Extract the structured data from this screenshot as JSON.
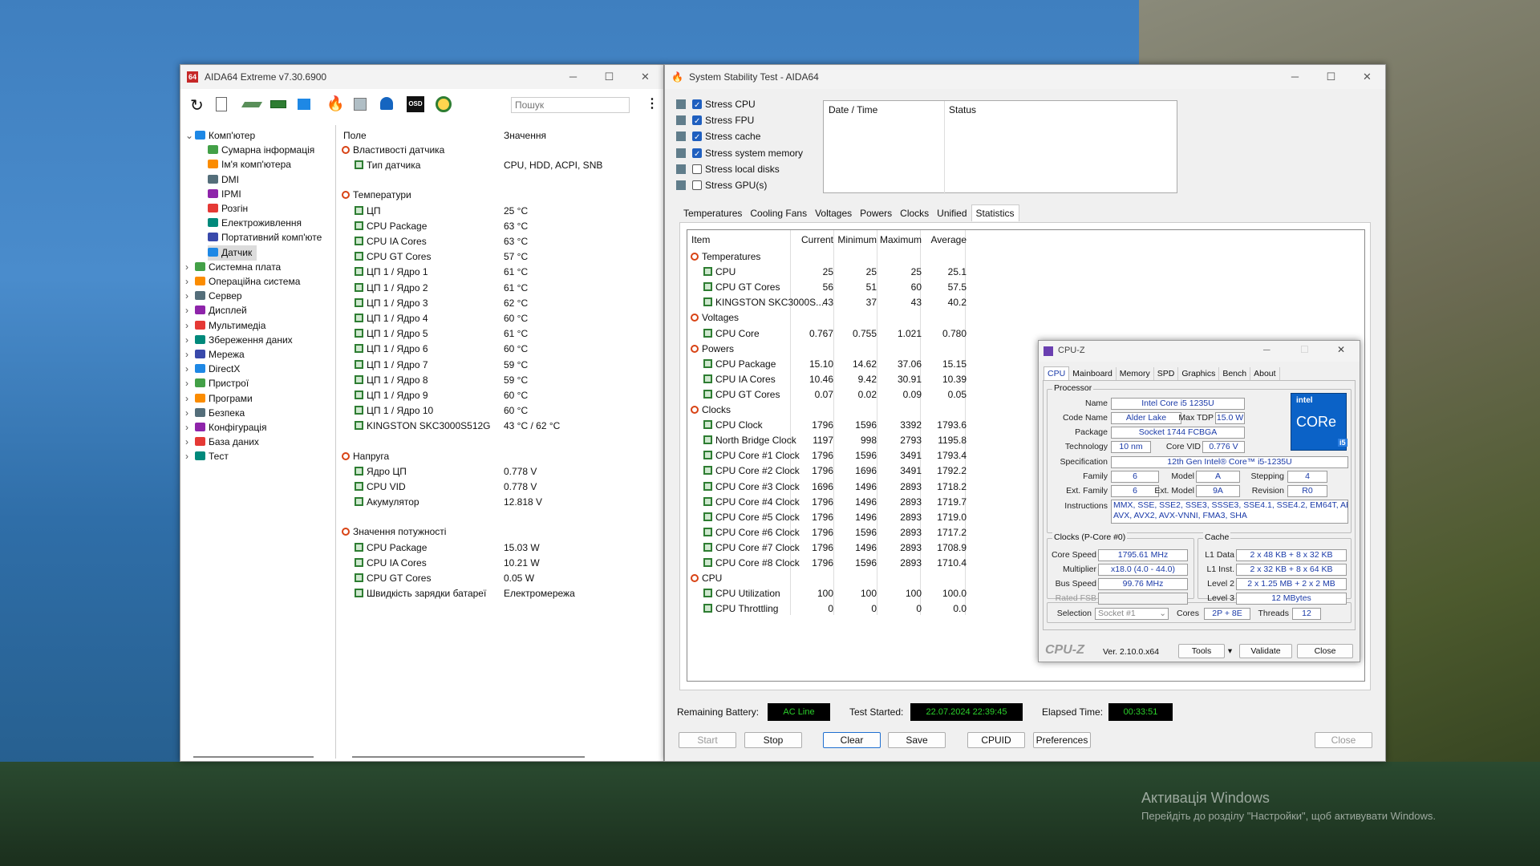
{
  "aida": {
    "title": "AIDA64 Extreme v7.30.6900",
    "search_placeholder": "Пошук",
    "tree": [
      {
        "label": "Комп'ютер",
        "level": 0,
        "exp": "⌄"
      },
      {
        "label": "Сумарна інформація",
        "level": 1
      },
      {
        "label": "Ім'я комп'ютера",
        "level": 1
      },
      {
        "label": "DMI",
        "level": 1
      },
      {
        "label": "IPMI",
        "level": 1
      },
      {
        "label": "Розгін",
        "level": 1
      },
      {
        "label": "Електроживлення",
        "level": 1
      },
      {
        "label": "Портативний комп'юте",
        "level": 1
      },
      {
        "label": "Датчик",
        "level": 1,
        "sel": true
      },
      {
        "label": "Системна плата",
        "level": 0,
        "exp": "›"
      },
      {
        "label": "Операційна система",
        "level": 0,
        "exp": "›"
      },
      {
        "label": "Сервер",
        "level": 0,
        "exp": "›"
      },
      {
        "label": "Дисплей",
        "level": 0,
        "exp": "›"
      },
      {
        "label": "Мультимедіа",
        "level": 0,
        "exp": "›"
      },
      {
        "label": "Збереження даних",
        "level": 0,
        "exp": "›"
      },
      {
        "label": "Мережа",
        "level": 0,
        "exp": "›"
      },
      {
        "label": "DirectX",
        "level": 0,
        "exp": "›"
      },
      {
        "label": "Пристрої",
        "level": 0,
        "exp": "›"
      },
      {
        "label": "Програми",
        "level": 0,
        "exp": "›"
      },
      {
        "label": "Безпека",
        "level": 0,
        "exp": "›"
      },
      {
        "label": "Конфігурація",
        "level": 0,
        "exp": "›"
      },
      {
        "label": "База даних",
        "level": 0,
        "exp": "›"
      },
      {
        "label": "Тест",
        "level": 0,
        "exp": "›"
      }
    ],
    "col_field": "Поле",
    "col_value": "Значення",
    "sections": [
      {
        "title": "Властивості датчика",
        "items": [
          {
            "f": "Тип датчика",
            "v": "CPU, HDD, ACPI, SNB"
          }
        ]
      },
      {
        "title": "Температури",
        "items": [
          {
            "f": "ЦП",
            "v": "25 °C"
          },
          {
            "f": "CPU Package",
            "v": "63 °C"
          },
          {
            "f": "CPU IA Cores",
            "v": "63 °C"
          },
          {
            "f": "CPU GT Cores",
            "v": "57 °C"
          },
          {
            "f": "ЦП 1 / Ядро 1",
            "v": "61 °C"
          },
          {
            "f": "ЦП 1 / Ядро 2",
            "v": "61 °C"
          },
          {
            "f": "ЦП 1 / Ядро 3",
            "v": "62 °C"
          },
          {
            "f": "ЦП 1 / Ядро 4",
            "v": "60 °C"
          },
          {
            "f": "ЦП 1 / Ядро 5",
            "v": "61 °C"
          },
          {
            "f": "ЦП 1 / Ядро 6",
            "v": "60 °C"
          },
          {
            "f": "ЦП 1 / Ядро 7",
            "v": "59 °C"
          },
          {
            "f": "ЦП 1 / Ядро 8",
            "v": "59 °C"
          },
          {
            "f": "ЦП 1 / Ядро 9",
            "v": "60 °C"
          },
          {
            "f": "ЦП 1 / Ядро 10",
            "v": "60 °C"
          },
          {
            "f": "KINGSTON SKC3000S512G",
            "v": "43 °C / 62 °C"
          }
        ]
      },
      {
        "title": "Напруга",
        "items": [
          {
            "f": "Ядро ЦП",
            "v": "0.778 V"
          },
          {
            "f": "CPU VID",
            "v": "0.778 V"
          },
          {
            "f": "Акумулятор",
            "v": "12.818 V"
          }
        ]
      },
      {
        "title": "Значення потужності",
        "items": [
          {
            "f": "CPU Package",
            "v": "15.03 W"
          },
          {
            "f": "CPU IA Cores",
            "v": "10.21 W"
          },
          {
            "f": "CPU GT Cores",
            "v": "0.05 W"
          },
          {
            "f": "Швидкість зарядки батареї",
            "v": "Електромережа"
          }
        ]
      }
    ]
  },
  "sst": {
    "title": "System Stability Test - AIDA64",
    "stress": [
      {
        "label": "Stress CPU",
        "on": true
      },
      {
        "label": "Stress FPU",
        "on": true
      },
      {
        "label": "Stress cache",
        "on": true
      },
      {
        "label": "Stress system memory",
        "on": true
      },
      {
        "label": "Stress local disks",
        "on": false
      },
      {
        "label": "Stress GPU(s)",
        "on": false
      }
    ],
    "log_cols": [
      "Date / Time",
      "Status"
    ],
    "tabs": [
      "Temperatures",
      "Cooling Fans",
      "Voltages",
      "Powers",
      "Clocks",
      "Unified",
      "Statistics"
    ],
    "active_tab": "Statistics",
    "stat_cols": [
      "Item",
      "Current",
      "Minimum",
      "Maximum",
      "Average"
    ],
    "stats": [
      {
        "g": "Temperatures"
      },
      {
        "i": "CPU",
        "c": "25",
        "mn": "25",
        "mx": "25",
        "a": "25.1"
      },
      {
        "i": "CPU GT Cores",
        "c": "56",
        "mn": "51",
        "mx": "60",
        "a": "57.5"
      },
      {
        "i": "KINGSTON SKC3000S...",
        "c": "43",
        "mn": "37",
        "mx": "43",
        "a": "40.2"
      },
      {
        "g": "Voltages"
      },
      {
        "i": "CPU Core",
        "c": "0.767",
        "mn": "0.755",
        "mx": "1.021",
        "a": "0.780"
      },
      {
        "g": "Powers"
      },
      {
        "i": "CPU Package",
        "c": "15.10",
        "mn": "14.62",
        "mx": "37.06",
        "a": "15.15"
      },
      {
        "i": "CPU IA Cores",
        "c": "10.46",
        "mn": "9.42",
        "mx": "30.91",
        "a": "10.39"
      },
      {
        "i": "CPU GT Cores",
        "c": "0.07",
        "mn": "0.02",
        "mx": "0.09",
        "a": "0.05"
      },
      {
        "g": "Clocks"
      },
      {
        "i": "CPU Clock",
        "c": "1796",
        "mn": "1596",
        "mx": "3392",
        "a": "1793.6"
      },
      {
        "i": "North Bridge Clock",
        "c": "1197",
        "mn": "998",
        "mx": "2793",
        "a": "1195.8"
      },
      {
        "i": "CPU Core #1 Clock",
        "c": "1796",
        "mn": "1596",
        "mx": "3491",
        "a": "1793.4"
      },
      {
        "i": "CPU Core #2 Clock",
        "c": "1796",
        "mn": "1696",
        "mx": "3491",
        "a": "1792.2"
      },
      {
        "i": "CPU Core #3 Clock",
        "c": "1696",
        "mn": "1496",
        "mx": "2893",
        "a": "1718.2"
      },
      {
        "i": "CPU Core #4 Clock",
        "c": "1796",
        "mn": "1496",
        "mx": "2893",
        "a": "1719.7"
      },
      {
        "i": "CPU Core #5 Clock",
        "c": "1796",
        "mn": "1496",
        "mx": "2893",
        "a": "1719.0"
      },
      {
        "i": "CPU Core #6 Clock",
        "c": "1796",
        "mn": "1596",
        "mx": "2893",
        "a": "1717.2"
      },
      {
        "i": "CPU Core #7 Clock",
        "c": "1796",
        "mn": "1496",
        "mx": "2893",
        "a": "1708.9"
      },
      {
        "i": "CPU Core #8 Clock",
        "c": "1796",
        "mn": "1596",
        "mx": "2893",
        "a": "1710.4"
      },
      {
        "g": "CPU"
      },
      {
        "i": "CPU Utilization",
        "c": "100",
        "mn": "100",
        "mx": "100",
        "a": "100.0"
      },
      {
        "i": "CPU Throttling",
        "c": "0",
        "mn": "0",
        "mx": "0",
        "a": "0.0"
      }
    ],
    "remaining_battery_label": "Remaining Battery:",
    "remaining_battery": "AC Line",
    "test_started_label": "Test Started:",
    "test_started": "22.07.2024 22:39:45",
    "elapsed_label": "Elapsed Time:",
    "elapsed": "00:33:51",
    "buttons": {
      "start": "Start",
      "stop": "Stop",
      "clear": "Clear",
      "save": "Save",
      "cpuid": "CPUID",
      "prefs": "Preferences",
      "close": "Close"
    }
  },
  "cpuz": {
    "title": "CPU-Z",
    "tabs": [
      "CPU",
      "Mainboard",
      "Memory",
      "SPD",
      "Graphics",
      "Bench",
      "About"
    ],
    "processor_label": "Processor",
    "name_l": "Name",
    "name": "Intel Core i5 1235U",
    "code_l": "Code Name",
    "code": "Alder Lake",
    "tdp_l": "Max TDP",
    "tdp": "15.0 W",
    "pkg_l": "Package",
    "pkg": "Socket 1744 FCBGA",
    "tech_l": "Technology",
    "tech": "10 nm",
    "vid_l": "Core VID",
    "vid": "0.776 V",
    "spec_l": "Specification",
    "spec": "12th Gen Intel® Core™ i5-1235U",
    "fam_l": "Family",
    "fam": "6",
    "model_l": "Model",
    "model": "A",
    "step_l": "Stepping",
    "step": "4",
    "xfam_l": "Ext. Family",
    "xfam": "6",
    "xmodel_l": "Ext. Model",
    "xmodel": "9A",
    "rev_l": "Revision",
    "rev": "R0",
    "inst_l": "Instructions",
    "inst1": "MMX, SSE, SSE2, SSE3, SSSE3, SSE4.1, SSE4.2, EM64T, AES,",
    "inst2": "AVX, AVX2, AVX-VNNI, FMA3, SHA",
    "clocks_label": "Clocks (P-Core #0)",
    "cache_label": "Cache",
    "cs_l": "Core Speed",
    "cs": "1795.61 MHz",
    "mult_l": "Multiplier",
    "mult": "x18.0 (4.0 - 44.0)",
    "bus_l": "Bus Speed",
    "bus": "99.76 MHz",
    "fsb_l": "Rated FSB",
    "l1d_l": "L1 Data",
    "l1d": "2 x 48 KB + 8 x 32 KB",
    "l1i_l": "L1 Inst.",
    "l1i": "2 x 32 KB + 8 x 64 KB",
    "l2_l": "Level 2",
    "l2": "2 x 1.25 MB + 2 x 2 MB",
    "l3_l": "Level 3",
    "l3": "12 MBytes",
    "sel_l": "Selection",
    "sel": "Socket #1",
    "cores_l": "Cores",
    "cores": "2P + 8E",
    "thr_l": "Threads",
    "thr": "12",
    "brand": "CPU-Z",
    "ver": "Ver. 2.10.0.x64",
    "tools": "Tools",
    "validate": "Validate",
    "close": "Close",
    "logo_top": "intel",
    "logo_mid": "CORe",
    "logo_bot": "i5"
  },
  "watermark1": "Активація Windows",
  "watermark2": "Перейдіть до розділу \"Настройки\", щоб активувати Windows."
}
